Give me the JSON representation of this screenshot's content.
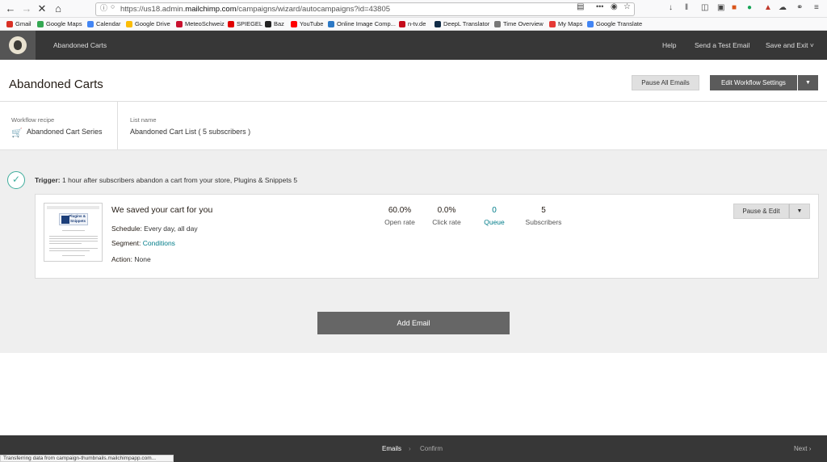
{
  "browser": {
    "url_prefix": "https://us18.admin.",
    "url_domain": "mailchimp.com",
    "url_suffix": "/campaigns/wizard/autocampaigns?id=43805",
    "right_icons": [
      "reader-icon",
      "pocket-icon",
      "star-icon"
    ],
    "overflow": "•••",
    "toolbar_icons": [
      "download-icon",
      "library-icon",
      "sidebar-icon",
      "extension-icon",
      "firefox-account-icon"
    ]
  },
  "bookmarks": [
    {
      "label": "Gmail",
      "color": "#d93025"
    },
    {
      "label": "Google Maps",
      "color": "#34a853"
    },
    {
      "label": "Calendar",
      "color": "#4285f4"
    },
    {
      "label": "Google Drive",
      "color": "#fbbc04"
    },
    {
      "label": "MeteoSchweiz",
      "color": "#c8102e"
    },
    {
      "label": "SPIEGEL",
      "color": "#e00000"
    },
    {
      "label": "Baz",
      "color": "#222222"
    },
    {
      "label": "YouTube",
      "color": "#ff0000"
    },
    {
      "label": "Online Image Comp...",
      "color": "#2b78c5"
    },
    {
      "label": "n-tv.de",
      "color": "#c40a1a"
    },
    {
      "label": "DeepL Translator",
      "color": "#0f2b46"
    },
    {
      "label": "Time Overview",
      "color": "#777777"
    },
    {
      "label": "My Maps",
      "color": "#e53935"
    },
    {
      "label": "Google Translate",
      "color": "#4285f4"
    }
  ],
  "appbar": {
    "title": "Abandoned Carts",
    "help": "Help",
    "send_test": "Send a Test Email",
    "save_exit": "Save and Exit",
    "chevron": "⌄"
  },
  "page": {
    "title": "Abandoned Carts",
    "pause_all": "Pause All Emails",
    "edit_workflow": "Edit Workflow Settings"
  },
  "info": {
    "recipe_label": "Workflow recipe",
    "recipe_value": "Abandoned Cart Series",
    "list_label": "List name",
    "list_value": "Abandoned Cart List ( 5 subscribers )"
  },
  "trigger": {
    "label": "Trigger:",
    "text": " 1 hour after subscribers abandon a cart from your store, Plugins & Snippets 5"
  },
  "email": {
    "title": "We saved your cart for you",
    "schedule_label": "Schedule:",
    "schedule_value": " Every day, all day",
    "segment_label": "Segment:",
    "segment_value": "Conditions",
    "action_label": "Action:",
    "action_value": " None",
    "thumb_logo": "Plugins & Snippets",
    "stats": [
      {
        "value": "60.0%",
        "label": "Open rate"
      },
      {
        "value": "0.0%",
        "label": "Click rate"
      },
      {
        "value": "0",
        "label": "Queue"
      },
      {
        "value": "5",
        "label": "Subscribers"
      }
    ],
    "pause_edit": "Pause & Edit"
  },
  "add_email": "Add Email",
  "footer": {
    "emails": "Emails",
    "confirm": "Confirm",
    "next": "Next"
  },
  "status_text": "Transferring data from campaign-thumbnails.mailchimpapp.com..."
}
